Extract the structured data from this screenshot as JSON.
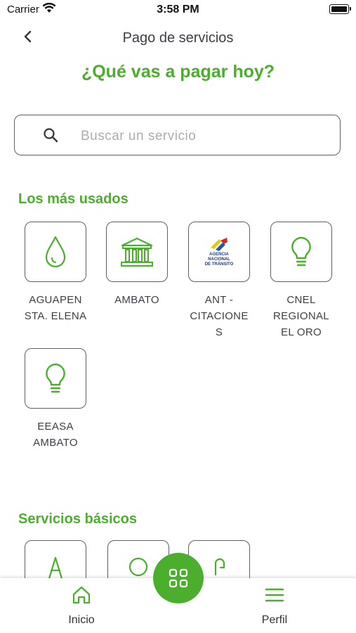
{
  "status_bar": {
    "carrier": "Carrier",
    "time": "3:58 PM"
  },
  "header": {
    "title": "Pago de servicios",
    "headline": "¿Qué vas a pagar hoy?"
  },
  "search": {
    "placeholder": "Buscar un servicio",
    "value": ""
  },
  "sections": {
    "most_used": {
      "title": "Los más usados",
      "items": [
        {
          "label": "AGUAPEN\nSTA. ELENA",
          "icon": "water-drop-icon"
        },
        {
          "label": "AMBATO",
          "icon": "municipal-building-icon"
        },
        {
          "label": "ANT -\nCITACIONE\nS",
          "icon": "ant-logo",
          "logo_text": "AGENCIA NACIONAL DE TRÁNSITO"
        },
        {
          "label": "CNEL\nREGIONAL\nEL ORO",
          "icon": "light-bulb-icon"
        },
        {
          "label": "EEASA\nAMBATO",
          "icon": "light-bulb-icon"
        }
      ]
    },
    "basic": {
      "title": "Servicios básicos"
    }
  },
  "bottom_nav": {
    "home_label": "Inicio",
    "profile_label": "Perfil"
  },
  "colors": {
    "accent": "#4cae2d",
    "text": "#3a3f47",
    "border": "#5b6068"
  }
}
